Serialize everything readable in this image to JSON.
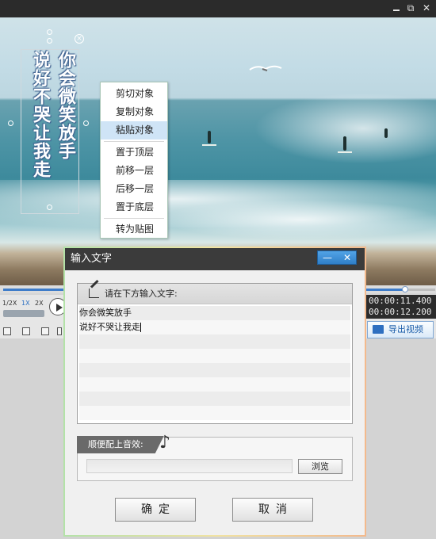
{
  "window": {
    "restore_glyph": "⧉",
    "close_glyph": "✕"
  },
  "overlay": {
    "column1": "你会微笑放手",
    "column2": "说好不哭让我走",
    "close_glyph": "×"
  },
  "context_menu": {
    "items": [
      {
        "label": "剪切对象",
        "selected": false
      },
      {
        "label": "复制对象",
        "selected": false
      },
      {
        "label": "粘贴对象",
        "selected": true
      },
      {
        "label": "置于顶层",
        "selected": false
      },
      {
        "label": "前移一层",
        "selected": false
      },
      {
        "label": "后移一层",
        "selected": false
      },
      {
        "label": "置于底层",
        "selected": false
      },
      {
        "label": "转为贴图",
        "selected": false
      }
    ]
  },
  "player": {
    "progress_fraction": 0.93,
    "speeds": [
      "1/2X",
      "1X",
      "2X"
    ],
    "active_speed": "1X",
    "current_time": "00:00:11.400",
    "total_time": "00:00:12.200",
    "export_label": "导出视频"
  },
  "dialog": {
    "title": "输入文字",
    "minimize_glyph": "—",
    "close_glyph": "✕",
    "panel_header": "请在下方输入文字:",
    "lines": [
      "你会微笑放手",
      "说好不哭让我走",
      "",
      "",
      "",
      "",
      "",
      ""
    ],
    "sfx_label": "顺便配上音效:",
    "note_glyph": "♪",
    "sfx_value": "",
    "browse_label": "浏览",
    "ok_label": "确定",
    "cancel_label": "取消"
  },
  "colors": {
    "title_bar": "#2b2b2b",
    "accent_blue": "#2f7fc8",
    "selected_menu": "#cfe4f6"
  }
}
